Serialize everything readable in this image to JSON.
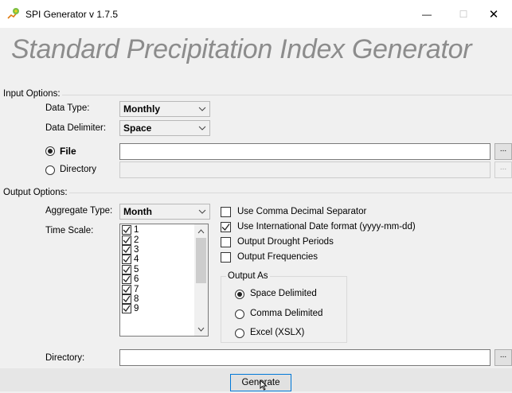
{
  "window": {
    "title": "SPI Generator  v 1.7.5",
    "app_icon": "spi-generator-app-icon",
    "minimize_glyph": "—",
    "maximize_glyph": "☐",
    "close_glyph": "✕"
  },
  "heading": "Standard Precipitation Index Generator",
  "input_options": {
    "group_label": "Input Options:",
    "data_type_label": "Data Type:",
    "data_type_value": "Monthly",
    "delimiter_label": "Data Delimiter:",
    "delimiter_value": "Space",
    "file_radio_label": "File",
    "file_selected": true,
    "directory_radio_label": "Directory",
    "file_path_value": "",
    "directory_path_value": "",
    "browse_label": "..."
  },
  "output_options": {
    "group_label": "Output Options:",
    "aggregate_type_label": "Aggregate Type:",
    "aggregate_type_value": "Month",
    "time_scale_label": "Time Scale:",
    "time_scale_items": [
      {
        "label": "1",
        "checked": true
      },
      {
        "label": "2",
        "checked": true
      },
      {
        "label": "3",
        "checked": true
      },
      {
        "label": "4",
        "checked": true
      },
      {
        "label": "5",
        "checked": true
      },
      {
        "label": "6",
        "checked": true
      },
      {
        "label": "7",
        "checked": true
      },
      {
        "label": "8",
        "checked": true
      },
      {
        "label": "9",
        "checked": true
      }
    ],
    "checkboxes": [
      {
        "label": "Use Comma Decimal Separator",
        "checked": false
      },
      {
        "label": "Use International Date format (yyyy-mm-dd)",
        "checked": true
      },
      {
        "label": "Output Drought Periods",
        "checked": false
      },
      {
        "label": "Output Frequencies",
        "checked": false
      }
    ],
    "output_as": {
      "group_label": "Output As",
      "options": [
        {
          "label": "Space Delimited",
          "selected": true
        },
        {
          "label": "Comma Delimited",
          "selected": false
        },
        {
          "label": "Excel (XSLX)",
          "selected": false
        }
      ]
    },
    "directory_label": "Directory:",
    "directory_value": "",
    "browse_label": "..."
  },
  "generate_button_label": "Generate"
}
